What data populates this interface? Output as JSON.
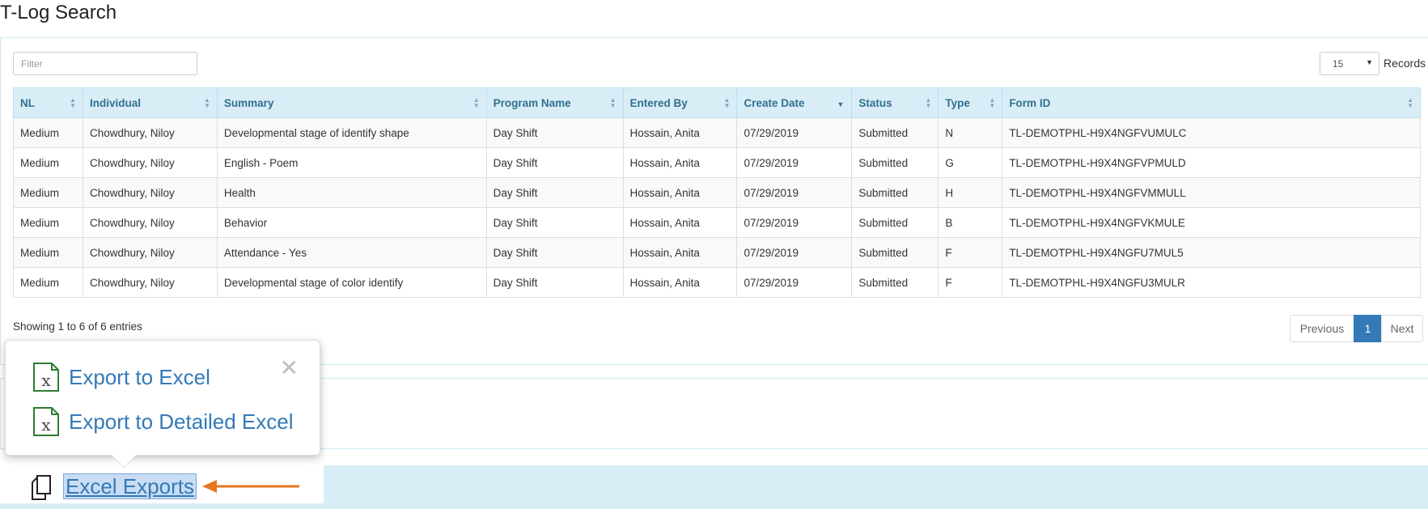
{
  "page": {
    "title": "T-Log Search"
  },
  "toolbar": {
    "filter_placeholder": "Filter",
    "records_value": "15",
    "records_label": "Records"
  },
  "table": {
    "headers": [
      "NL",
      "Individual",
      "Summary",
      "Program Name",
      "Entered By",
      "Create Date",
      "Status",
      "Type",
      "Form ID"
    ],
    "rows": [
      [
        "Medium",
        "Chowdhury, Niloy",
        "Developmental stage of identify shape",
        "Day Shift",
        "Hossain, Anita",
        "07/29/2019",
        "Submitted",
        "N",
        "TL-DEMOTPHL-H9X4NGFVUMULC"
      ],
      [
        "Medium",
        "Chowdhury, Niloy",
        "English - Poem",
        "Day Shift",
        "Hossain, Anita",
        "07/29/2019",
        "Submitted",
        "G",
        "TL-DEMOTPHL-H9X4NGFVPMULD"
      ],
      [
        "Medium",
        "Chowdhury, Niloy",
        "Health",
        "Day Shift",
        "Hossain, Anita",
        "07/29/2019",
        "Submitted",
        "H",
        "TL-DEMOTPHL-H9X4NGFVMMULL"
      ],
      [
        "Medium",
        "Chowdhury, Niloy",
        "Behavior",
        "Day Shift",
        "Hossain, Anita",
        "07/29/2019",
        "Submitted",
        "B",
        "TL-DEMOTPHL-H9X4NGFVKMULE"
      ],
      [
        "Medium",
        "Chowdhury, Niloy",
        "Attendance - Yes",
        "Day Shift",
        "Hossain, Anita",
        "07/29/2019",
        "Submitted",
        "F",
        "TL-DEMOTPHL-H9X4NGFU7MUL5"
      ],
      [
        "Medium",
        "Chowdhury, Niloy",
        "Developmental stage of color identify",
        "Day Shift",
        "Hossain, Anita",
        "07/29/2019",
        "Submitted",
        "F",
        "TL-DEMOTPHL-H9X4NGFU3MULR"
      ]
    ]
  },
  "pagination": {
    "showing": "Showing 1 to 6 of 6 entries",
    "previous": "Previous",
    "page": "1",
    "next": "Next"
  },
  "popover": {
    "export_excel": "Export to Excel",
    "export_detailed": "Export to Detailed Excel",
    "close": "✕"
  },
  "footer": {
    "excel_exports": "Excel Exports"
  },
  "colors": {
    "header_bg": "#d9edf7",
    "link": "#337ab7",
    "arrow": "#e87722",
    "excel_icon": "#2e7d32"
  }
}
